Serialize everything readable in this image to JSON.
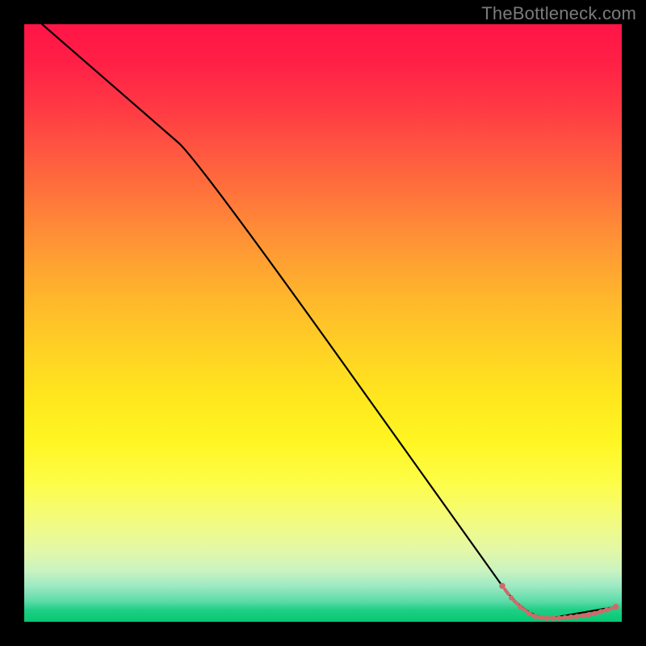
{
  "watermark": "TheBottleneck.com",
  "colors": {
    "line": "#000000",
    "markers": "#cd6b69",
    "background": "#000000"
  },
  "chart_data": {
    "type": "line",
    "title": "",
    "xlabel": "",
    "ylabel": "",
    "xlim": [
      0,
      100
    ],
    "ylim": [
      0,
      100
    ],
    "series": [
      {
        "name": "curve",
        "x": [
          3,
          26,
          30,
          80,
          88,
          99
        ],
        "y": [
          100,
          80,
          76,
          6,
          0.6,
          2.5
        ]
      }
    ],
    "markers": {
      "name": "points",
      "x": [
        80,
        81.5,
        83,
        84.5,
        85.5,
        86.5,
        87.5,
        88.5,
        89.5,
        90.5,
        91.5,
        92.5,
        93.5,
        94.5,
        95.5,
        96.5,
        97.5,
        99
      ],
      "y": [
        6.0,
        4.0,
        2.5,
        1.4,
        0.9,
        0.7,
        0.6,
        0.6,
        0.6,
        0.7,
        0.8,
        0.9,
        1.0,
        1.2,
        1.4,
        1.7,
        2.0,
        2.5
      ]
    }
  }
}
